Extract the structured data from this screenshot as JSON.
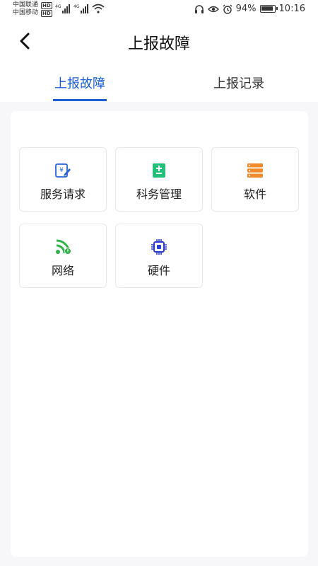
{
  "status_bar": {
    "carrier1": "中国联通",
    "carrier2": "中国移动",
    "hd_badge": "HD",
    "network_label": "4G",
    "battery_percent": "94%",
    "battery_level": 0.94,
    "time": "10:16"
  },
  "header": {
    "title": "上报故障"
  },
  "tabs": [
    {
      "label": "上报故障",
      "active": true
    },
    {
      "label": "上报记录",
      "active": false
    }
  ],
  "categories": [
    {
      "label": "服务请求",
      "icon": "service-request-icon",
      "color": "#2a63d8"
    },
    {
      "label": "科务管理",
      "icon": "department-management-icon",
      "color": "#22c07a"
    },
    {
      "label": "软件",
      "icon": "software-icon",
      "color": "#f08a2a"
    },
    {
      "label": "网络",
      "icon": "network-icon",
      "color": "#2fb24a"
    },
    {
      "label": "硬件",
      "icon": "hardware-icon",
      "color": "#2a3fd8"
    }
  ]
}
